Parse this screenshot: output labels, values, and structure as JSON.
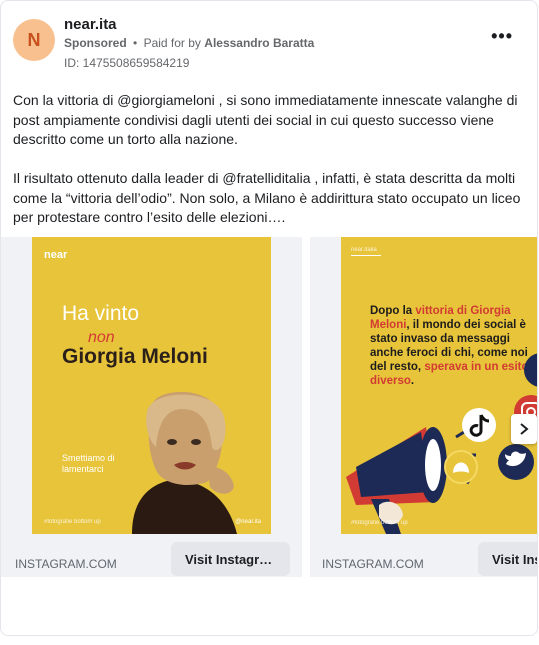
{
  "ad": {
    "avatar_letter": "N",
    "page_name": "near.ita",
    "sponsored": "Sponsored",
    "separator": "•",
    "paid_for_by": "Paid for by",
    "payer": "Alessandro Baratta",
    "id_label": "ID: 1475508659584219",
    "more_label": "•••"
  },
  "body": {
    "paragraph1": "Con la vittoria di @giorgiameloni , si sono immediatamente innescate valanghe di post ampiamente condivisi dagli utenti dei social in cui questo successo viene descritto come un torto alla nazione.",
    "paragraph2": "Il risultato ottenuto dalla leader di @fratelliditalia , infatti, è stata descritta da molti come la “vittoria dell’odio”. Non solo, a Milano è addirittura stato occupato un liceo per protestare contro l’esito delle elezioni…."
  },
  "cards": [
    {
      "logo": "near",
      "headline_top": "Ha vinto",
      "headline_strike": "non",
      "headline_bottom": "Giorgia Meloni",
      "caption": "Smettiamo di lamentarci",
      "credit_left": "#fotografie bottom up",
      "credit_right": "@near.ita",
      "url": "INSTAGRAM.COM",
      "cta": "Visit Instagr…"
    },
    {
      "top_small": "near.italia",
      "text_a": "Dopo la ",
      "text_red1": "vittoria di Giorgia Meloni",
      "text_b": ", il mondo dei social è stato invaso da messaggi anche feroci di chi, come noi del resto, ",
      "text_red2": "sperava in un esito diverso",
      "text_c": ".",
      "credit": "#fotografie bottom up",
      "url": "INSTAGRAM.COM",
      "cta": "Visit Instagram"
    }
  ],
  "icons": {
    "next": "chevron-right-icon",
    "tiktok": "tiktok-icon",
    "twitter": "twitter-icon",
    "snapchat": "snapchat-icon",
    "instagram": "instagram-icon",
    "megaphone": "megaphone-icon"
  },
  "colors": {
    "creative_yellow": "#e8c43a",
    "accent_red": "#d23b33",
    "avatar_bg": "#f9c08f",
    "cta_bg": "#e4e6eb"
  }
}
